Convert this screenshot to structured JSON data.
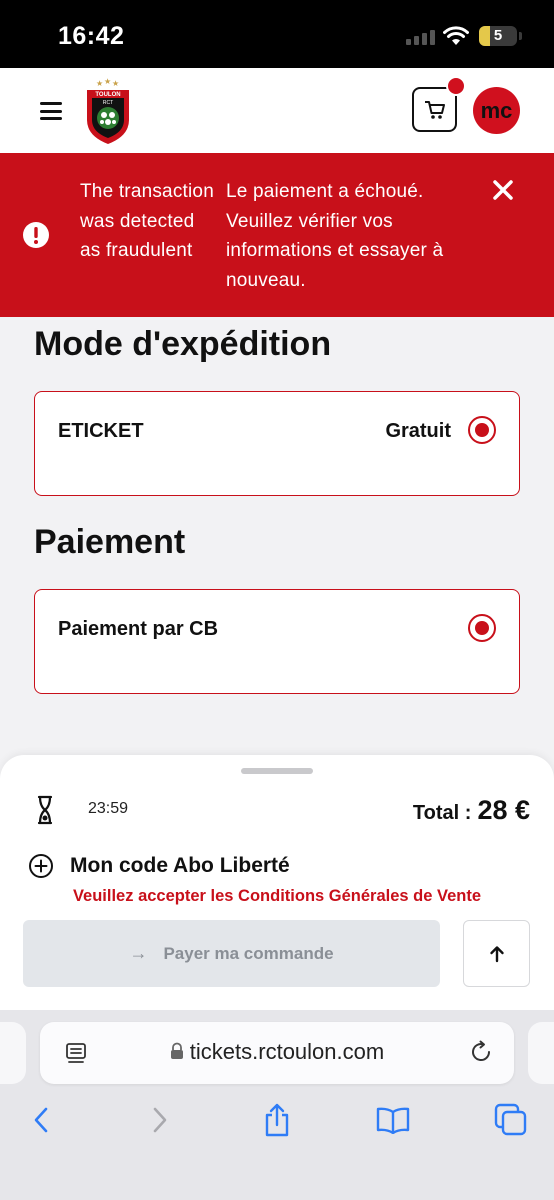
{
  "status_bar": {
    "time": "16:42",
    "battery_level": "5"
  },
  "header": {
    "logo_text": "TOULON",
    "logo_sub": "RCT",
    "avatar_initials": "mc"
  },
  "alert": {
    "message_en": "The transaction was detected as fraudulent",
    "message_fr": "Le paiement a échoué. Veuillez vérifier vos informations et essayer à nouveau."
  },
  "shipping": {
    "title": "Mode d'expédition",
    "option_label": "ETICKET",
    "option_price": "Gratuit",
    "selected": true
  },
  "payment": {
    "title": "Paiement",
    "option_label": "Paiement par CB",
    "selected": true
  },
  "sheet": {
    "timer": "23:59",
    "total_label": "Total :",
    "total_value": "28 €",
    "promo_label": "Mon code Abo Liberté",
    "cgv_warning": "Veuillez accepter les Conditions Générales de Vente",
    "pay_button": "Payer ma commande",
    "pay_arrow": "→"
  },
  "browser": {
    "url": "tickets.rctoulon.com"
  },
  "colors": {
    "brand_red": "#c8101a",
    "disabled_button": "#e3e6ea",
    "safari_blue": "#2f7cf6"
  }
}
